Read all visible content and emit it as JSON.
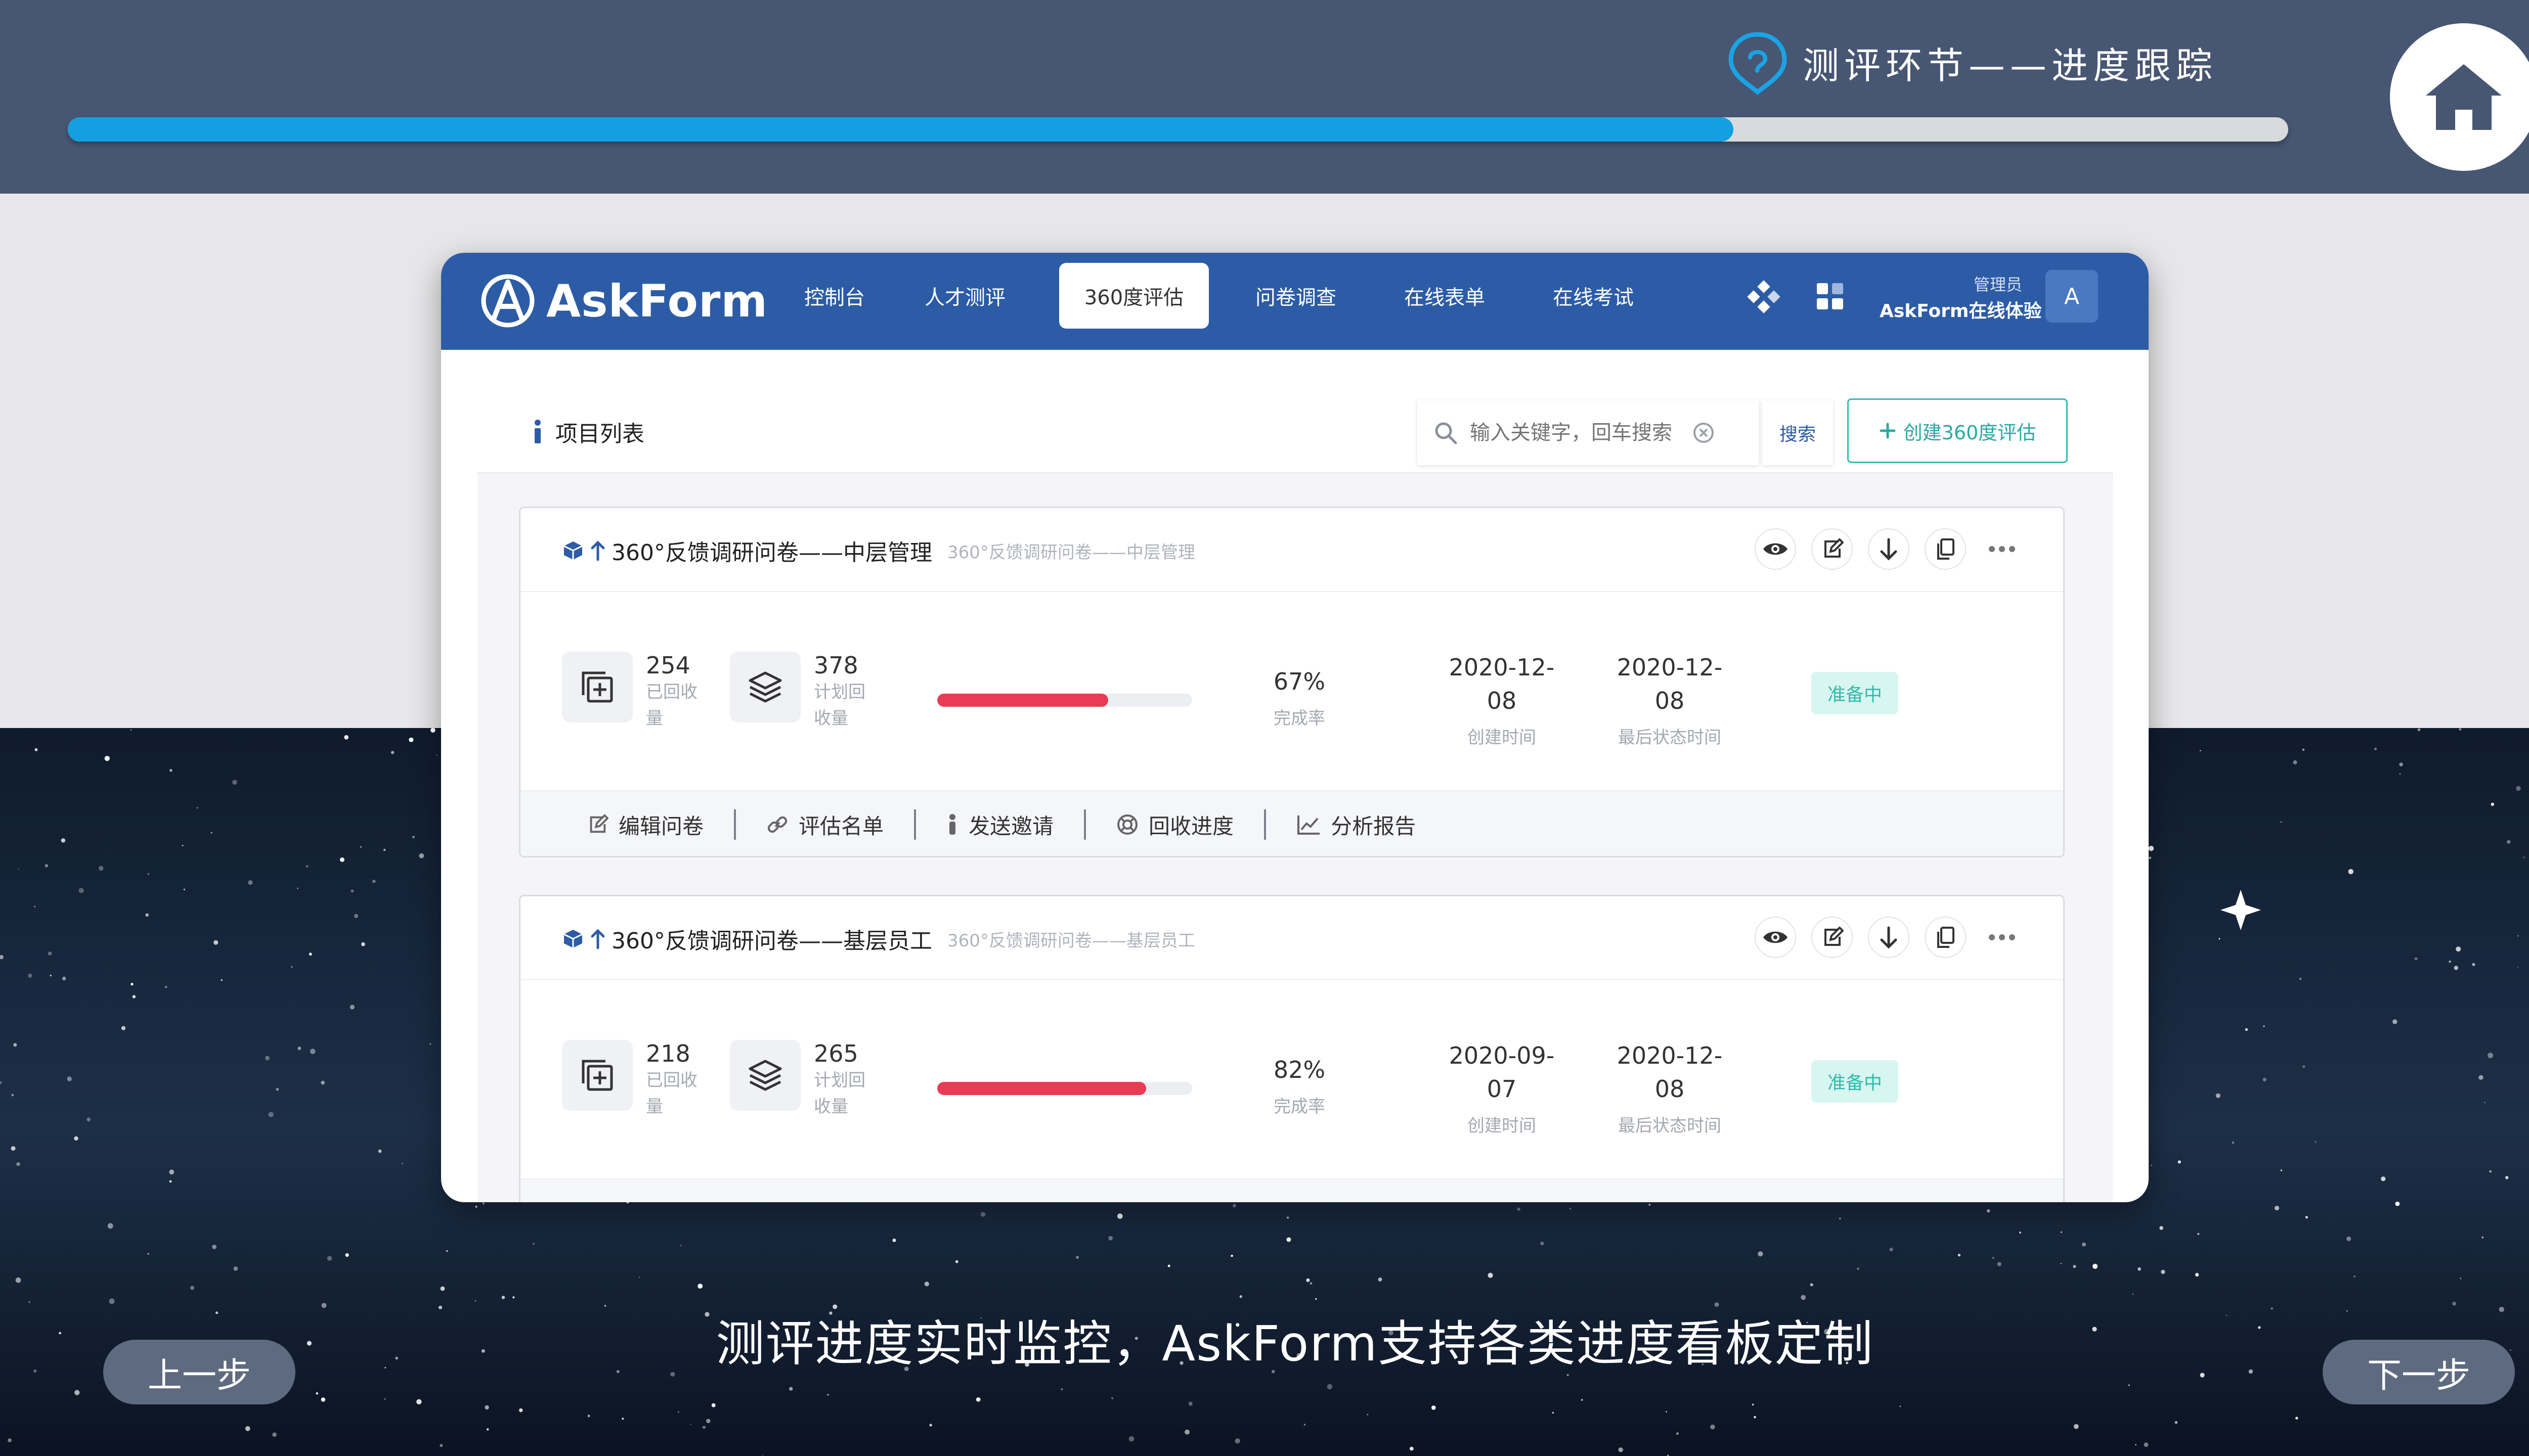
{
  "header": {
    "step_title": "测评环节——进度跟踪",
    "progress_percent": 75,
    "accent_color": "#149fe2"
  },
  "app": {
    "brand": "AskForm",
    "nav": {
      "items": [
        {
          "label": "控制台"
        },
        {
          "label": "人才测评"
        },
        {
          "label": "360度评估",
          "active": true
        },
        {
          "label": "问卷调查"
        },
        {
          "label": "在线表单"
        },
        {
          "label": "在线考试"
        }
      ],
      "user_role": "管理员",
      "user_name": "AskForm在线体验",
      "avatar_letter": "A"
    },
    "list": {
      "title": "项目列表",
      "search_placeholder": "输入关键字，回车搜索",
      "search_button": "搜索",
      "create_button": "创建360度评估"
    },
    "projects": [
      {
        "title": "360°反馈调研问卷——中层管理",
        "subtitle": "360°反馈调研问卷——中层管理",
        "collected": "254",
        "collected_label": "已回收量",
        "planned": "378",
        "planned_label": "计划回收量",
        "progress_fraction": 0.67,
        "completion": "67%",
        "completion_label": "完成率",
        "created_line1": "2020-12-",
        "created_line2": "08",
        "created_label": "创建时间",
        "updated_line1": "2020-12-",
        "updated_line2": "08",
        "updated_label": "最后状态时间",
        "status": "准备中",
        "footer": [
          "编辑问卷",
          "评估名单",
          "发送邀请",
          "回收进度",
          "分析报告"
        ]
      },
      {
        "title": "360°反馈调研问卷——基层员工",
        "subtitle": "360°反馈调研问卷——基层员工",
        "collected": "218",
        "collected_label": "已回收量",
        "planned": "265",
        "planned_label": "计划回收量",
        "progress_fraction": 0.82,
        "completion": "82%",
        "completion_label": "完成率",
        "created_line1": "2020-09-",
        "created_line2": "07",
        "created_label": "创建时间",
        "updated_line1": "2020-12-",
        "updated_line2": "08",
        "updated_label": "最后状态时间",
        "status": "准备中"
      }
    ]
  },
  "caption": "测评进度实时监控，AskForm支持各类进度看板定制",
  "prev_label": "上一步",
  "next_label": "下一步"
}
